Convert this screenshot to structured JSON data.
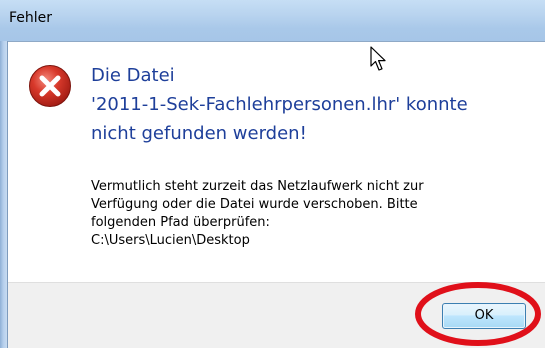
{
  "dialog": {
    "title": "Fehler",
    "headline": {
      "line1": "Die Datei",
      "line2": "'2011-1-Sek-Fachlehrpersonen.lhr' konnte",
      "line3": "nicht gefunden werden!"
    },
    "body": {
      "line1": "Vermutlich steht zurzeit das Netzlaufwerk nicht zur",
      "line2": "Verfügung oder die Datei wurde verschoben. Bitte",
      "line3": "folgenden Pfad überprüfen:",
      "line4": "C:\\Users\\Lucien\\Desktop"
    },
    "ok_label": "OK",
    "icon": "error-icon"
  },
  "colors": {
    "headline": "#1e3f9a",
    "annotation": "#e0101a",
    "error_icon": "#c42b1c"
  }
}
